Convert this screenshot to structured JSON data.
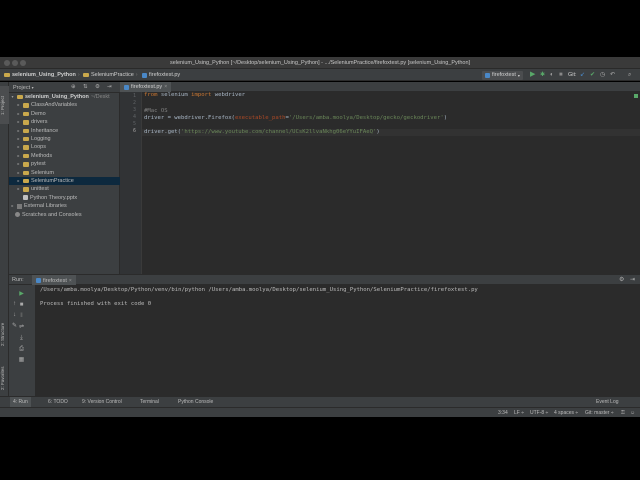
{
  "window": {
    "title": "selenium_Using_Python [~/Desktop/selenium_Using_Python] - .../SeleniumPractice/firefoxtest.py [selenium_Using_Python]"
  },
  "navbar": {
    "crumbs": [
      "selenium_Using_Python",
      "SeleniumPractice",
      "firefoxtest.py"
    ],
    "run_config": "firefoxtest",
    "git_label": "Git:"
  },
  "project": {
    "header": "Project",
    "root": "selenium_Using_Python",
    "root_path": "~/Deskt",
    "items": [
      {
        "label": "ClassAndVariables",
        "type": "folder"
      },
      {
        "label": "Demo",
        "type": "folder"
      },
      {
        "label": "drivers",
        "type": "folder"
      },
      {
        "label": "Inheritance",
        "type": "folder"
      },
      {
        "label": "Logging",
        "type": "folder"
      },
      {
        "label": "Loops",
        "type": "folder"
      },
      {
        "label": "Methods",
        "type": "folder"
      },
      {
        "label": "pytest",
        "type": "folder"
      },
      {
        "label": "Selenium",
        "type": "folder"
      },
      {
        "label": "SeleniumPractice",
        "type": "folder",
        "selected": true
      },
      {
        "label": "unittest",
        "type": "folder"
      },
      {
        "label": "Python Theory.pptx",
        "type": "file"
      }
    ],
    "external": "External Libraries",
    "scratches": "Scratches and Consoles"
  },
  "editor": {
    "tab": "firefoxtest.py",
    "line_numbers": [
      "1",
      "2",
      "3",
      "4",
      "5",
      "6"
    ],
    "line1_kw_from": "from",
    "line1_module": " selenium ",
    "line1_kw_import": "import",
    "line1_name": " webdriver",
    "line3_comment": "#Mac OS",
    "line4_a": "driver = webdriver.Firefox(",
    "line4_param": "executable_path",
    "line4_b": "=",
    "line4_str": "'/Users/amba.moolya/Desktop/gecko/geckodriver'",
    "line4_c": ")",
    "line6_a": "driver.get(",
    "line6_str": "'https://www.youtube.com/channel/UCsK2llvaNkhg06eYYuIFAeQ'",
    "line6_c": ")"
  },
  "run": {
    "label": "Run:",
    "tab": "firefoxtest",
    "command": "/Users/amba.moolya/Desktop/Python/venv/bin/python /Users/amba.moolya/Desktop/selenium_Using_Python/SeleniumPractice/firefoxtest.py",
    "exit": "Process finished with exit code 0"
  },
  "left_tabs": {
    "project": "1: Project",
    "structure": "2: Structure",
    "favorites": "2: Favorites"
  },
  "bottom_tabs": [
    "4: Run",
    "6: TODO",
    "9: Version Control",
    "Terminal",
    "Python Console"
  ],
  "event_log": "Event Log",
  "status": {
    "position": "3:34",
    "line_sep": "LF ÷",
    "encoding": "UTF-8 ÷",
    "indent": "4 spaces ÷",
    "git": "Git: master ÷"
  }
}
